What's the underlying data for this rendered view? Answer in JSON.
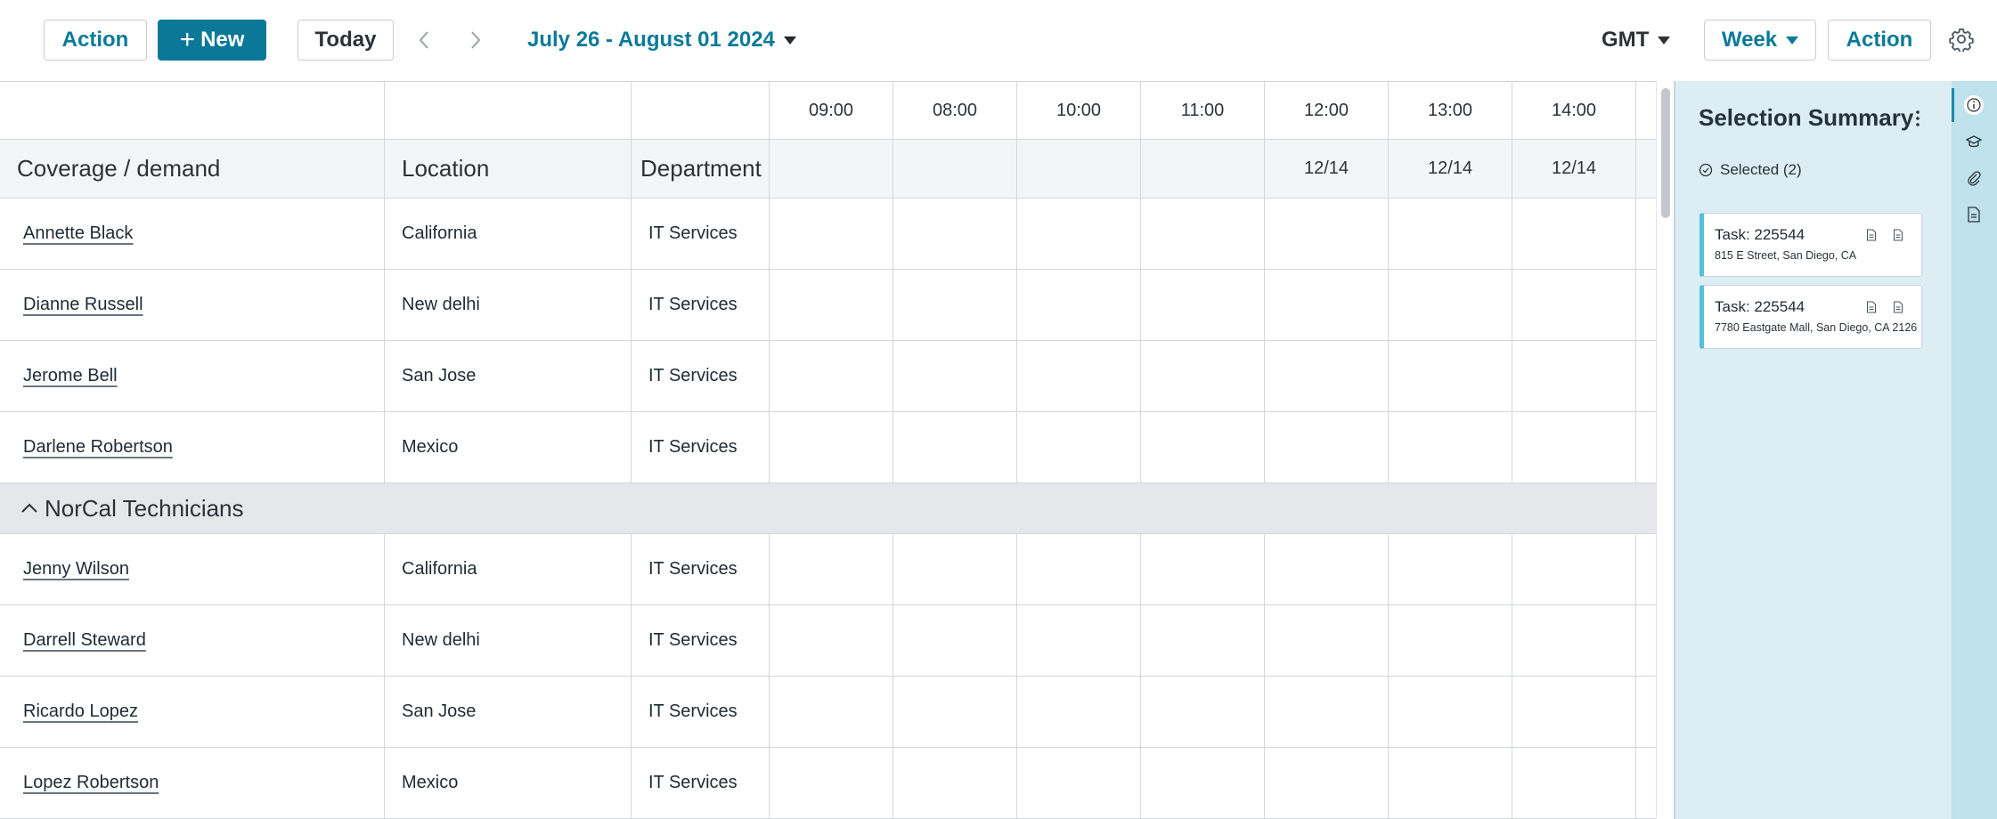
{
  "toolbar": {
    "action_left_label": "Action",
    "new_label": "New",
    "today_label": "Today",
    "date_range": "July 26 - August 01 2024",
    "timezone": "GMT",
    "view_label": "Week",
    "action_right_label": "Action"
  },
  "table": {
    "time_headers": [
      "09:00",
      "08:00",
      "10:00",
      "11:00",
      "12:00",
      "13:00",
      "14:00"
    ],
    "column_headers": {
      "coverage": "Coverage / demand",
      "location": "Location",
      "department": "Department"
    },
    "date_headers": [
      "",
      "",
      "",
      "",
      "12/14",
      "12/14",
      "12/14"
    ],
    "rows_a": [
      {
        "name": "Annette Black",
        "location": "California",
        "department": "IT Services"
      },
      {
        "name": "Dianne Russell",
        "location": "New delhi",
        "department": "IT Services"
      },
      {
        "name": "Jerome Bell",
        "location": "San Jose",
        "department": "IT Services"
      },
      {
        "name": "Darlene Robertson",
        "location": "Mexico",
        "department": "IT Services"
      }
    ],
    "group_label": "NorCal Technicians",
    "rows_b": [
      {
        "name": "Jenny Wilson",
        "location": "California",
        "department": "IT Services"
      },
      {
        "name": "Darrell Steward",
        "location": "New delhi",
        "department": "IT Services"
      },
      {
        "name": "Ricardo Lopez",
        "location": "San Jose",
        "department": "IT Services"
      },
      {
        "name": "Lopez Robertson",
        "location": "Mexico",
        "department": "IT Services"
      }
    ]
  },
  "summary": {
    "title": "Selection Summary",
    "selected_label": "Selected (2)",
    "tasks": [
      {
        "title": "Task: 225544",
        "address": "815 E Street, San Diego, CA"
      },
      {
        "title": "Task: 225544",
        "address": "7780 Eastgate Mall, San Diego, CA 2126"
      }
    ]
  },
  "colors": {
    "brand_teal": "#0c7897",
    "panel_bg": "#dcedf3",
    "rail_bg": "#bfe2ec",
    "task_accent": "#52c1de"
  }
}
